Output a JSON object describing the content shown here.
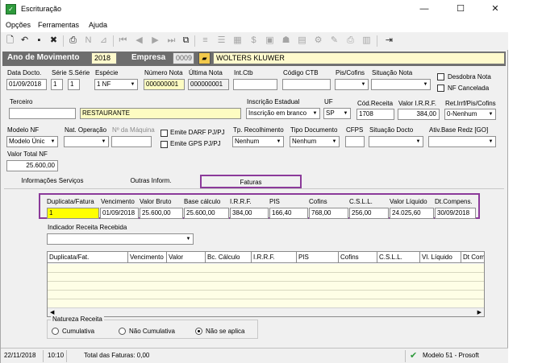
{
  "window": {
    "title": "Escrituração",
    "minimize": "—",
    "maximize": "☐",
    "close": "✕"
  },
  "menu": [
    "Opções",
    "Ferramentas",
    "Ajuda"
  ],
  "header": {
    "ano_label": "Ano de Movimento",
    "ano_value": "2018",
    "empresa_label": "Empresa",
    "empresa_code": "0009",
    "empresa_name": "WOLTERS KLUWER"
  },
  "row1": {
    "data_docto_label": "Data Docto.",
    "data_docto_value": "01/09/2018",
    "serie_label": "Série",
    "serie_value": "1",
    "s_serie_label": "S.Série",
    "s_serie_value": "1",
    "especie_label": "Espécie",
    "especie_value": "1 NF",
    "numero_nota_label": "Número Nota",
    "numero_nota_value": "000000001",
    "ultima_nota_label": "Última Nota",
    "ultima_nota_value": "000000001",
    "int_ctb_label": "Int.Ctb",
    "codigo_ctb_label": "Código CTB",
    "pis_cofins_label": "Pis/Cofins",
    "situacao_nota_label": "Situação Nota",
    "desdobra_nota_label": "Desdobra Nota",
    "nf_cancelada_label": "NF Cancelada"
  },
  "row2": {
    "terceiro_label": "Terceiro",
    "terceiro_name": "RESTAURANTE",
    "inscricao_label": "Inscrição Estadual",
    "inscricao_value": "Inscrição em branco",
    "uf_label": "UF",
    "uf_value": "SP",
    "cod_receita_label": "Cód.Receita",
    "cod_receita_value": "1708",
    "valor_irrf_label": "Valor I.R.R.F.",
    "valor_irrf_value": "384,00",
    "ret_irrf_label": "Ret.Irrf/Pis/Cofins",
    "ret_irrf_value": "0-Nenhum"
  },
  "row3": {
    "modelo_nf_label": "Modelo NF",
    "modelo_nf_value": "Modelo Únic",
    "nat_operacao_label": "Nat. Operação",
    "n_maquina_label": "Nº da Máquina",
    "emite_darf_label": "Emite DARF PJ/PJ",
    "emite_gps_label": "Emite GPS PJ/PJ",
    "tp_recolhimento_label": "Tp. Recolhimento",
    "tp_recolhimento_value": "Nenhum",
    "tipo_documento_label": "Tipo Documento",
    "tipo_documento_value": "Nenhum",
    "cfps_label": "CFPS",
    "situacao_docto_label": "Situação Docto",
    "ativ_base_label": "Ativ.Base Redz [GO]",
    "valor_total_label": "Valor Total NF",
    "valor_total_value": "25.600,00"
  },
  "tabs": [
    "Informações Serviços",
    "Outras Inform.",
    "Faturas"
  ],
  "fatura": {
    "headers": [
      "Duplicata/Fatura",
      "Vencimento",
      "Valor Bruto",
      "Base cálculo",
      "I.R.R.F.",
      "PIS",
      "Cofins",
      "C.S.L.L.",
      "Valor Líquido",
      "Dt.Compens."
    ],
    "values": [
      "1",
      "01/09/2018",
      "25.600,00",
      "25.600,00",
      "384,00",
      "166,40",
      "768,00",
      "256,00",
      "24.025,60",
      "30/09/2018"
    ]
  },
  "indicador_label": "Indicador Receita Recebida",
  "grid": {
    "headers": [
      "Duplicata/Fat.",
      "Vencimento",
      "Valor",
      "Bc. Cálculo",
      "I.R.R.F.",
      "PIS",
      "Cofins",
      "C.S.L.L.",
      "Vl. Líquido",
      "Dt Com"
    ]
  },
  "natureza": {
    "title": "Natureza Receita",
    "options": [
      "Cumulativa",
      "Não Cumulativa",
      "Não se aplica"
    ],
    "selected": "Não se aplica"
  },
  "status": {
    "date": "22/11/2018",
    "time": "10:10",
    "total": "Total das Faturas: 0,00",
    "modelo": "Modelo 51 - Prosoft"
  },
  "colors": {
    "yellow_field": "#fdfcc2",
    "highlight_purple": "#8b3a9a",
    "year_bar": "#6d6d6d",
    "active_cell": "#ffff00"
  }
}
